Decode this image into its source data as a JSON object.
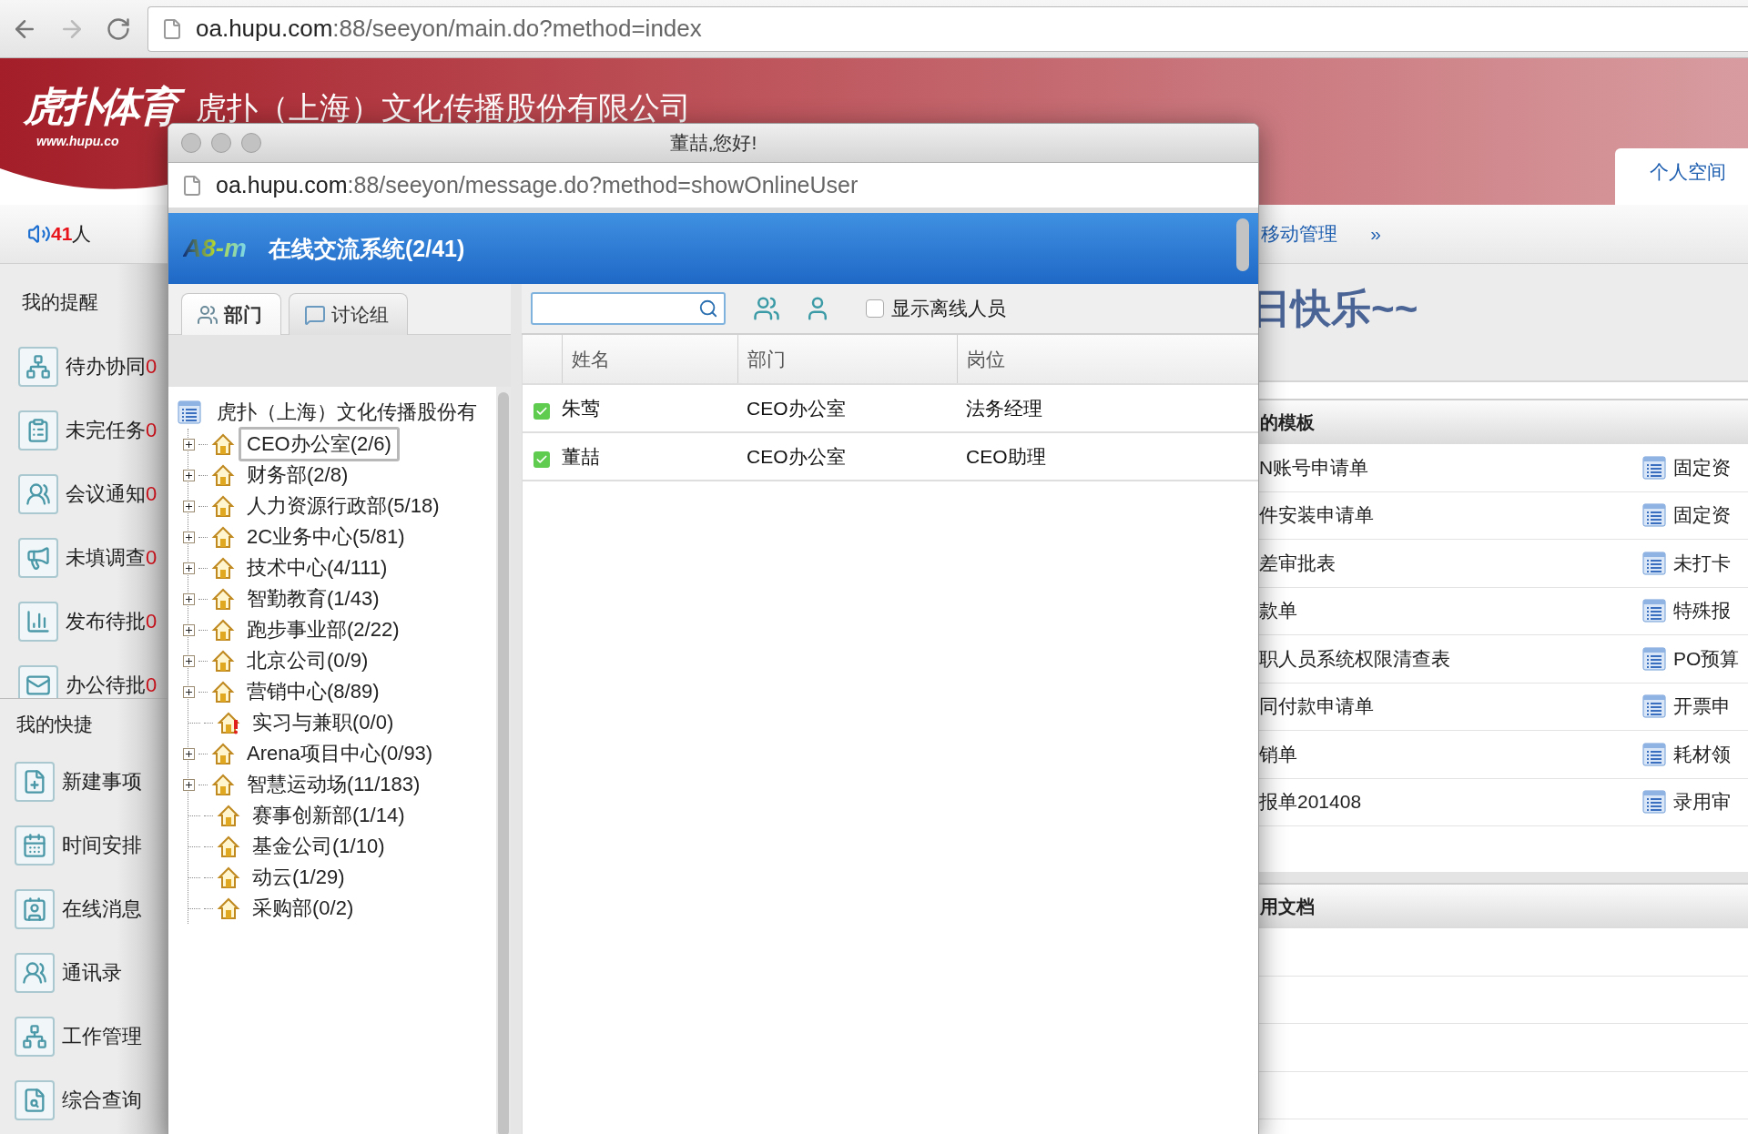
{
  "browser": {
    "url_host": "oa.hupu.com",
    "url_path": ":88/seeyon/main.do?method=index"
  },
  "header": {
    "logo": "虎扑体育",
    "logo_url": "www.hupu.co",
    "company": "虎扑（上海）文化传播股份有限公司",
    "tabs": [
      {
        "label": "个人空间",
        "selected": true
      }
    ]
  },
  "navbar": {
    "online_count": "41",
    "online_unit": "人",
    "items": [
      "移动管理"
    ],
    "more": "»"
  },
  "sidebar": {
    "sections": [
      {
        "title": "我的提醒",
        "items": [
          {
            "label": "待办协同",
            "count": "0"
          },
          {
            "label": "未完任务",
            "count": "0"
          },
          {
            "label": "会议通知",
            "count": "0"
          },
          {
            "label": "未填调查",
            "count": "0"
          },
          {
            "label": "发布待批",
            "count": "0"
          },
          {
            "label": "办公待批",
            "count": "0"
          }
        ]
      },
      {
        "title": "我的快捷",
        "items": [
          {
            "label": "新建事项"
          },
          {
            "label": "时间安排"
          },
          {
            "label": "在线消息"
          },
          {
            "label": "通讯录"
          },
          {
            "label": "工作管理"
          },
          {
            "label": "综合查询"
          }
        ]
      }
    ]
  },
  "main": {
    "greeting": "日快乐~~",
    "panels": [
      {
        "title": "的模板",
        "rows": [
          {
            "column_1": "N账号申请单",
            "column_2": "固定资"
          },
          {
            "column_1": "件安装申请单",
            "column_2": "固定资"
          },
          {
            "column_1": "差审批表",
            "column_2": "未打卡"
          },
          {
            "column_1": "款单",
            "column_2": "特殊报"
          },
          {
            "column_1": "职人员系统权限清查表",
            "column_2": "PO预算"
          },
          {
            "column_1": "同付款申请单",
            "column_2": "开票申"
          },
          {
            "column_1": "销单",
            "column_2": "耗材领"
          },
          {
            "column_1": "报单201408",
            "column_2": "录用审"
          }
        ]
      },
      {
        "title": "用文档"
      }
    ]
  },
  "popup": {
    "title": "董喆,您好!",
    "url_host": "oa.hupu.com",
    "url_path": ":88/seeyon/message.do?method=showOnlineUser",
    "app_logo": "A8-m",
    "app_title": "在线交流系统(2/41)",
    "tabs": [
      {
        "label": "部门",
        "selected": true
      },
      {
        "label": "讨论组",
        "selected": false
      }
    ],
    "tree": {
      "label": "虎扑（上海）文化传播股份有",
      "children": [
        {
          "label": "CEO办公室(2/6)",
          "selected": true,
          "expandable": true,
          "kind": "dept"
        },
        {
          "label": "财务部(2/8)",
          "selected": false,
          "expandable": true,
          "kind": "dept"
        },
        {
          "label": "人力资源行政部(5/18)",
          "selected": false,
          "expandable": true,
          "kind": "dept"
        },
        {
          "label": "2C业务中心(5/81)",
          "selected": false,
          "expandable": true,
          "kind": "dept"
        },
        {
          "label": "技术中心(4/111)",
          "selected": false,
          "expandable": true,
          "kind": "dept"
        },
        {
          "label": "智勤教育(1/43)",
          "selected": false,
          "expandable": true,
          "kind": "dept"
        },
        {
          "label": "跑步事业部(2/22)",
          "selected": false,
          "expandable": true,
          "kind": "dept"
        },
        {
          "label": "北京公司(0/9)",
          "selected": false,
          "expandable": true,
          "kind": "dept"
        },
        {
          "label": "营销中心(8/89)",
          "selected": false,
          "expandable": true,
          "kind": "dept"
        },
        {
          "label": "实习与兼职(0/0)",
          "selected": false,
          "expandable": false,
          "kind": "warning"
        },
        {
          "label": "Arena项目中心(0/93)",
          "selected": false,
          "expandable": true,
          "kind": "dept"
        },
        {
          "label": "智慧运动场(11/183)",
          "selected": false,
          "expandable": true,
          "kind": "dept"
        },
        {
          "label": "赛事创新部(1/14)",
          "selected": false,
          "expandable": false,
          "kind": "dept"
        },
        {
          "label": "基金公司(1/10)",
          "selected": false,
          "expandable": false,
          "kind": "dept"
        },
        {
          "label": "动云(1/29)",
          "selected": false,
          "expandable": false,
          "kind": "dept"
        },
        {
          "label": "采购部(0/2)",
          "selected": false,
          "expandable": false,
          "kind": "dept"
        }
      ]
    },
    "show_offline": {
      "label": "显示离线人员",
      "checked": false
    },
    "table": {
      "columns": [
        "姓名",
        "部门",
        "岗位"
      ],
      "rows": [
        {
          "online": true,
          "cells": [
            "朱莺",
            "CEO办公室",
            "法务经理"
          ]
        },
        {
          "online": true,
          "cells": [
            "董喆",
            "CEO办公室",
            "CEO助理"
          ]
        }
      ]
    }
  }
}
